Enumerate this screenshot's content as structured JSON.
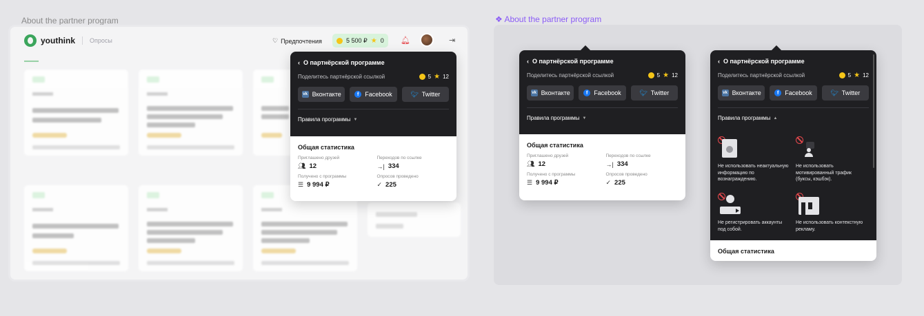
{
  "frames": {
    "left_title": "About the partner program",
    "right_title": "About the partner program"
  },
  "header": {
    "logo": "youthink",
    "section": "Опросы",
    "preferences": "Предпочтения",
    "balance": "5 500 ₽",
    "stars": "0"
  },
  "popover": {
    "title": "О партнёрской программе",
    "share_text": "Поделитесь партнёрской ссылкой",
    "coins": "5",
    "stars": "12",
    "buttons": {
      "vk": "Вконтакте",
      "facebook": "Facebook",
      "twitter": "Twitter"
    },
    "rules_label": "Правила программы"
  },
  "stats": {
    "title": "Общая статистика",
    "invited_label": "Приглашено друзей",
    "invited_value": "12",
    "clicks_label": "Переходов по ссылке",
    "clicks_value": "334",
    "earned_label": "Получено с программы",
    "earned_value": "9 994 ₽",
    "surveys_label": "Опросов проведено",
    "surveys_value": "225"
  },
  "rules": [
    {
      "text": "Не использовать неактуальную информацию по вознаграждению.",
      "icon": "document-icon"
    },
    {
      "text": "Не использовать мотивированный трафик (буксы, кэшбэк).",
      "icon": "person-icon"
    },
    {
      "text": "Не регистрировать аккаунты под собой.",
      "icon": "account-icon"
    },
    {
      "text": "Не использовать контекстную рекламу.",
      "icon": "ad-icon"
    }
  ],
  "colors": {
    "accent": "#3ba55c",
    "purple": "#8b5cf6",
    "dark": "#1f1f22"
  }
}
